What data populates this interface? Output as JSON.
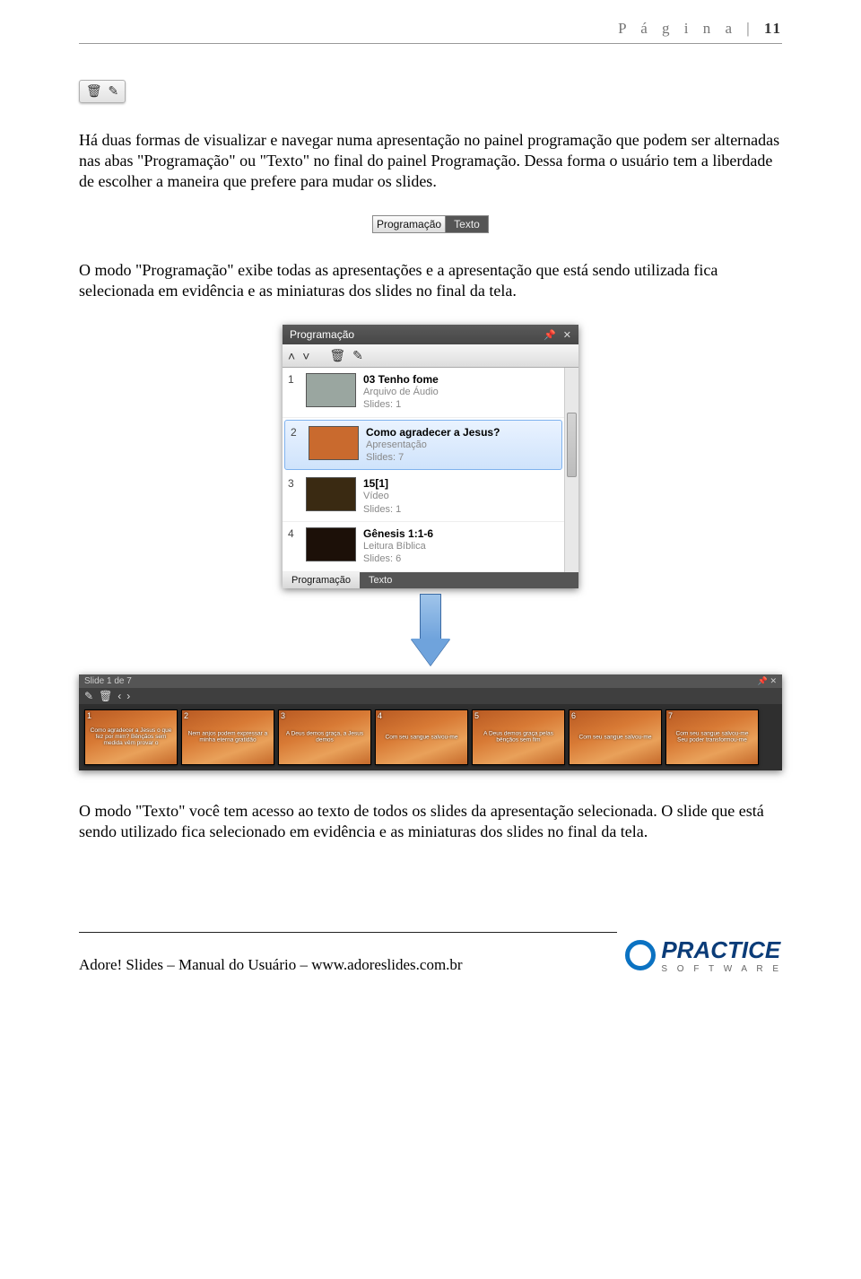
{
  "header": {
    "label": "P á g i n a",
    "divider": " | ",
    "number": "11"
  },
  "paragraphs": {
    "p1": "Há duas formas de visualizar e navegar numa apresentação no painel programação que podem ser alternadas nas abas \"Programação\" ou \"Texto\" no final do painel Programação. Dessa forma o usuário tem a liberdade de escolher a maneira que prefere para mudar os slides.",
    "p2": "O modo \"Programação\" exibe todas as apresentações e a apresentação que está sendo utilizada fica selecionada em evidência e as miniaturas dos slides no final da tela.",
    "p3": "O modo \"Texto\" você tem acesso ao texto de todos os slides da apresentação selecionada. O slide que está sendo utilizado fica selecionado em evidência e as miniaturas dos slides no final da tela."
  },
  "mini_tabs": {
    "active": "Programação",
    "inactive": "Texto"
  },
  "panel": {
    "title": "Programação",
    "tabs": {
      "active": "Programação",
      "inactive": "Texto"
    },
    "items": [
      {
        "idx": "1",
        "title": "03 Tenho fome",
        "type": "Arquivo de Áudio",
        "count": "Slides: 1",
        "thumb": "#9aa6a0",
        "selected": false
      },
      {
        "idx": "2",
        "title": "Como agradecer a Jesus?",
        "type": "Apresentação",
        "count": "Slides: 7",
        "thumb": "#c96a2e",
        "selected": true
      },
      {
        "idx": "3",
        "title": "15[1]",
        "type": "Vídeo",
        "count": "Slides: 1",
        "thumb": "#3a2a12",
        "selected": false
      },
      {
        "idx": "4",
        "title": "Gênesis 1:1-6",
        "type": "Leitura Bíblica",
        "count": "Slides: 6",
        "thumb": "#1c1008",
        "selected": false
      }
    ]
  },
  "strip": {
    "head": "Slide 1 de 7",
    "slides": [
      {
        "n": "1",
        "t": "Como agradecer a Jesus o que fez por mim? Bênçãos sem medida vêm provar o"
      },
      {
        "n": "2",
        "t": "Nem anjos podem expressar a minha eterna gratidão"
      },
      {
        "n": "3",
        "t": "A Deus demos graça, a Jesus demos"
      },
      {
        "n": "4",
        "t": "Com seu sangue salvou-me"
      },
      {
        "n": "5",
        "t": "A Deus demos graça pelas bênçãos sem fim"
      },
      {
        "n": "6",
        "t": "Com seu sangue salvou-me"
      },
      {
        "n": "7",
        "t": "Com seu sangue salvou-me Seu poder transformou-me"
      }
    ]
  },
  "footer": {
    "text": "Adore! Slides – Manual do Usuário – www.adoreslides.com.br",
    "logo_main": "PRACTICE",
    "logo_sub": "S O F T W A R E"
  }
}
